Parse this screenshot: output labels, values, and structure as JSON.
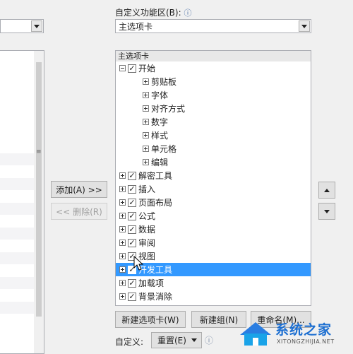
{
  "left": {
    "combo_value": ""
  },
  "right": {
    "label": "自定义功能区(B):",
    "info_icon": "ⓘ",
    "combo_value": "主选项卡",
    "tree_header": "主选项卡",
    "tree": [
      {
        "label": "开始",
        "level": 0,
        "expanded": true,
        "checked": true
      },
      {
        "label": "剪贴板",
        "level": 1,
        "expanded": false,
        "checked": null
      },
      {
        "label": "字体",
        "level": 1,
        "expanded": false,
        "checked": null
      },
      {
        "label": "对齐方式",
        "level": 1,
        "expanded": false,
        "checked": null
      },
      {
        "label": "数字",
        "level": 1,
        "expanded": false,
        "checked": null
      },
      {
        "label": "样式",
        "level": 1,
        "expanded": false,
        "checked": null
      },
      {
        "label": "单元格",
        "level": 1,
        "expanded": false,
        "checked": null
      },
      {
        "label": "编辑",
        "level": 1,
        "expanded": false,
        "checked": null
      },
      {
        "label": "解密工具",
        "level": 0,
        "expanded": false,
        "checked": true
      },
      {
        "label": "插入",
        "level": 0,
        "expanded": false,
        "checked": true
      },
      {
        "label": "页面布局",
        "level": 0,
        "expanded": false,
        "checked": true
      },
      {
        "label": "公式",
        "level": 0,
        "expanded": false,
        "checked": true
      },
      {
        "label": "数据",
        "level": 0,
        "expanded": false,
        "checked": true
      },
      {
        "label": "审阅",
        "level": 0,
        "expanded": false,
        "checked": true
      },
      {
        "label": "视图",
        "level": 0,
        "expanded": false,
        "checked": true
      },
      {
        "label": "开发工具",
        "level": 0,
        "expanded": false,
        "checked": true,
        "selected": true
      },
      {
        "label": "加载项",
        "level": 0,
        "expanded": false,
        "checked": true
      },
      {
        "label": "背景消除",
        "level": 0,
        "expanded": false,
        "checked": true
      }
    ]
  },
  "buttons": {
    "add": "添加(A) >>",
    "remove": "<< 删除(R)",
    "new_tab": "新建选项卡(W)",
    "new_group": "新建组(N)",
    "rename": "重命名(M)..."
  },
  "bottom": {
    "custom_label": "自定义:",
    "reset": "重置(E)",
    "info_icon": "ⓘ"
  },
  "watermark": {
    "text": "系统之家",
    "url": "XITONGZHIJIA.NET"
  },
  "colors": {
    "selection": "#3399ff",
    "window_bg": "#f0f0f0"
  }
}
